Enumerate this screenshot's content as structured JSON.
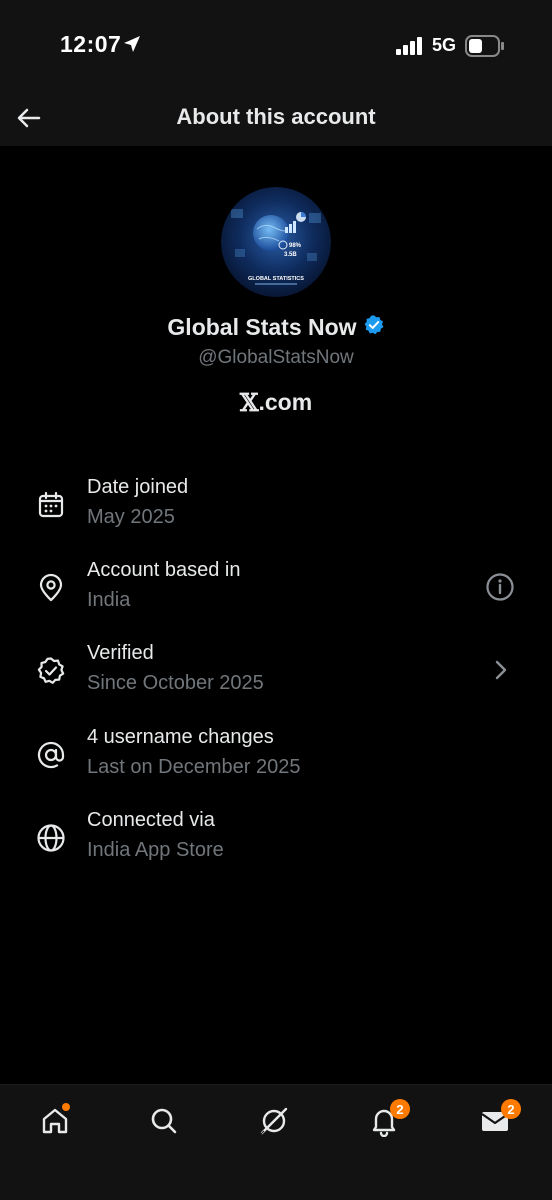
{
  "status_bar": {
    "time": "12:07",
    "network": "5G"
  },
  "header": {
    "title": "About this account"
  },
  "profile": {
    "name": "Global Stats Now",
    "handle": "@GlobalStatsNow",
    "platform_x": "𝕏",
    "platform_suffix": ".com",
    "avatar_text": "GLOBAL STATISTICS",
    "avatar_stat_a": "98%",
    "avatar_stat_b": "3.5B"
  },
  "info_rows": [
    {
      "icon": "calendar-icon",
      "title": "Date joined",
      "subtitle": "May 2025"
    },
    {
      "icon": "location-pin-icon",
      "title": "Account based in",
      "subtitle": "India",
      "action_icon": "info-icon"
    },
    {
      "icon": "verified-badge-icon",
      "title": "Verified",
      "subtitle": "Since October 2025",
      "action_icon": "chevron-right-icon"
    },
    {
      "icon": "at-sign-icon",
      "title": "4 username changes",
      "subtitle": "Last on December 2025"
    },
    {
      "icon": "globe-icon",
      "title": "Connected via",
      "subtitle": "India App Store"
    }
  ],
  "bottom_nav": {
    "items": [
      "home-icon",
      "search-icon",
      "grok-icon",
      "notifications-icon",
      "messages-icon"
    ],
    "notifications_badge": "2",
    "messages_badge": "2"
  },
  "colors": {
    "background": "#000000",
    "bar_background": "#121212",
    "primary_text": "#e7e9ea",
    "secondary_text": "#71767b",
    "verified_blue": "#1d9bf0",
    "badge_orange": "#ff7a00"
  }
}
